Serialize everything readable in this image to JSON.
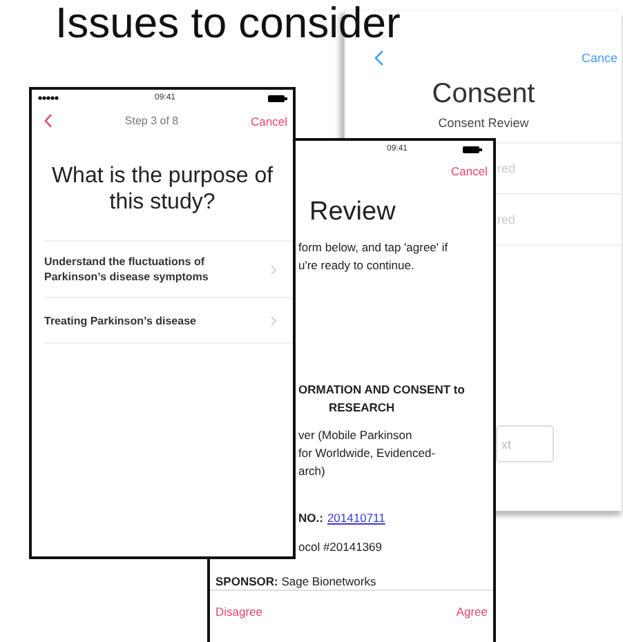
{
  "title": "Issues to consider",
  "consent_screen": {
    "cancel": "Cance",
    "title": "Consent",
    "subtitle": "Consent Review",
    "fields": [
      {
        "text": "red"
      },
      {
        "text": "red"
      }
    ],
    "button": "xt"
  },
  "question_screen": {
    "status_time": "09:41",
    "step": "Step 3 of 8",
    "cancel": "Cancel",
    "question": "What is the purpose of this study?",
    "options": [
      {
        "label": "Understand the fluctuations of Parkinson’s disease symptoms"
      },
      {
        "label": "Treating Parkinson’s disease"
      }
    ]
  },
  "review_screen": {
    "status_time": "09:41",
    "cancel": "Cancel",
    "title": "Review",
    "intro": [
      "form below, and tap 'agree' if",
      "u're ready to continue."
    ],
    "heading": [
      "ORMATION AND CONSENT to",
      "RESEARCH"
    ],
    "body": [
      "ver (Mobile Parkinson",
      "for Worldwide, Evidenced-",
      "arch)"
    ],
    "number_label": "NO.:",
    "number_link": "201410711",
    "protocol": "ocol #20141369",
    "sponsor": "**SPONSOR:** Sage Bionetworks",
    "disagree": "Disagree",
    "agree": "Agree"
  }
}
